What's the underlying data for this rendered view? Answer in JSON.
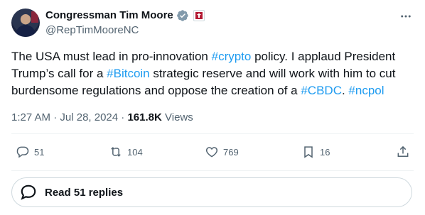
{
  "author": {
    "display_name": "Congressman Tim Moore",
    "handle": "@RepTimMooreNC"
  },
  "tweet": {
    "segments": [
      {
        "text": "The USA must lead in pro-innovation ",
        "kind": "text"
      },
      {
        "text": "#crypto",
        "kind": "hashtag"
      },
      {
        "text": " policy. I applaud President Trump’s call for a ",
        "kind": "text"
      },
      {
        "text": "#Bitcoin",
        "kind": "hashtag"
      },
      {
        "text": " strategic reserve and will work with him to cut burdensome regulations and oppose the creation of a ",
        "kind": "text"
      },
      {
        "text": "#CBDC",
        "kind": "hashtag"
      },
      {
        "text": ". ",
        "kind": "text"
      },
      {
        "text": "#ncpol",
        "kind": "hashtag"
      }
    ]
  },
  "meta": {
    "time": "1:27 AM",
    "date": "Jul 28, 2024",
    "views_count": "161.8K",
    "views_label": "Views"
  },
  "actions": {
    "replies": "51",
    "reposts": "104",
    "likes": "769",
    "bookmarks": "16"
  },
  "read_replies_label": "Read 51 replies",
  "colors": {
    "link": "#1d9bf0",
    "text": "#0f1419",
    "secondary": "#536471",
    "border": "#cfd9de",
    "verified": "#829aab"
  },
  "icons": {
    "verified": "verified-badge-icon",
    "affiliate": "affiliate-logo-icon",
    "more": "more-options-icon",
    "reply": "reply-icon",
    "repost": "repost-icon",
    "like": "like-icon",
    "bookmark": "bookmark-icon",
    "share": "share-icon",
    "replies": "speech-bubble-icon"
  }
}
